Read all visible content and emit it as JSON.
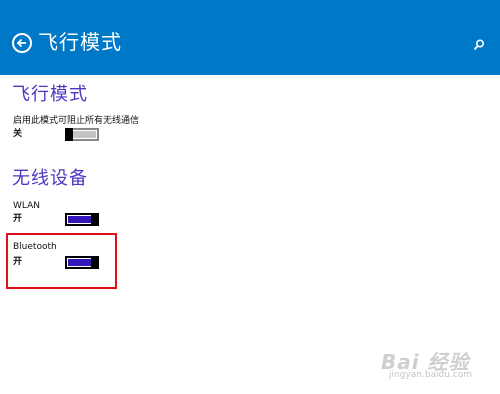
{
  "header": {
    "title": "飞行模式",
    "background": "#0078c8",
    "back_icon": "back-arrow-circle-icon",
    "search_icon": "search-icon"
  },
  "airplane": {
    "section_title": "飞行模式",
    "description": "启用此模式可阻止所有无线通信",
    "state_label": "关",
    "toggle_on": false
  },
  "wireless": {
    "section_title": "无线设备",
    "devices": [
      {
        "name": "WLAN",
        "state_label": "开",
        "toggle_on": true
      },
      {
        "name": "Bluetooth",
        "state_label": "开",
        "toggle_on": true
      }
    ]
  },
  "accent_color": "#4a38c4",
  "toggle_on_color": "#3314b4",
  "highlight_color": "#e0101a",
  "watermark": {
    "main": "Bai 经验",
    "sub": "jingyan.baidu.com"
  }
}
